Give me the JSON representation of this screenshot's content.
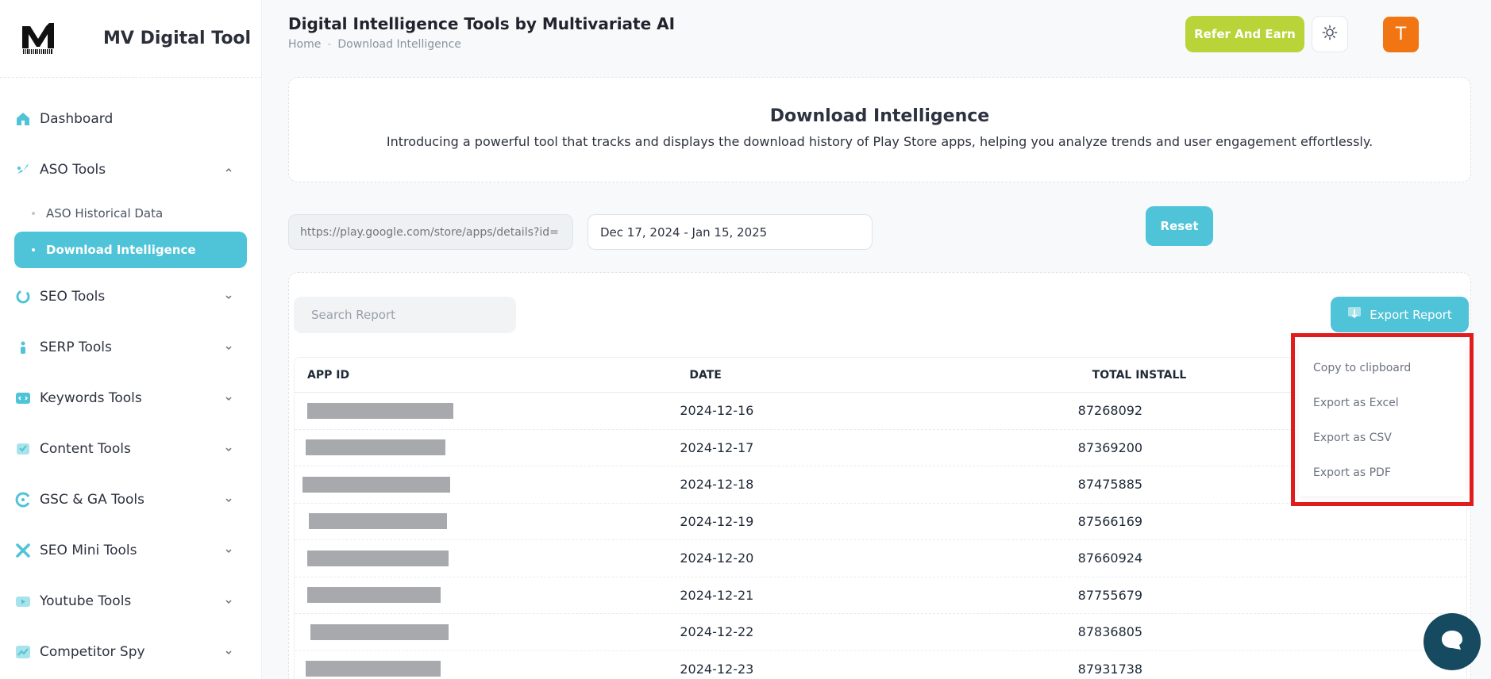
{
  "brand": {
    "name": "MV Digital Tool"
  },
  "sidebar": {
    "items": [
      {
        "label": "Dashboard",
        "icon": "home-icon"
      },
      {
        "label": "ASO Tools",
        "icon": "rocket-icon",
        "expanded": true,
        "children": [
          {
            "label": "ASO Historical Data"
          },
          {
            "label": "Download Intelligence",
            "active": true
          }
        ]
      },
      {
        "label": "SEO Tools",
        "icon": "seo-icon"
      },
      {
        "label": "SERP Tools",
        "icon": "serp-icon"
      },
      {
        "label": "Keywords Tools",
        "icon": "code-icon"
      },
      {
        "label": "Content Tools",
        "icon": "content-icon"
      },
      {
        "label": "GSC & GA Tools",
        "icon": "gsc-icon"
      },
      {
        "label": "SEO Mini Tools",
        "icon": "tools-icon"
      },
      {
        "label": "Youtube Tools",
        "icon": "youtube-icon"
      },
      {
        "label": "Competitor Spy",
        "icon": "chart-icon"
      }
    ]
  },
  "header": {
    "title": "Digital Intelligence Tools by Multivariate AI",
    "breadcrumb": [
      "Home",
      "Download Intelligence"
    ],
    "refer_label": "Refer And Earn",
    "avatar_initial": "T"
  },
  "intro": {
    "title": "Download Intelligence",
    "description": "Introducing a powerful tool that tracks and displays the download history of Play Store apps, helping you analyze trends and user engagement effortlessly."
  },
  "filters": {
    "url_placeholder": "https://play.google.com/store/apps/details?id=",
    "date_range": "Dec 17, 2024 - Jan 15, 2025",
    "reset_label": "Reset"
  },
  "report": {
    "search_placeholder": "Search Report",
    "export_label": "Export Report",
    "columns": [
      "APP ID",
      "DATE",
      "TOTAL INSTALL"
    ],
    "rows": [
      {
        "date": "2024-12-16",
        "installs": "87268092"
      },
      {
        "date": "2024-12-17",
        "installs": "87369200"
      },
      {
        "date": "2024-12-18",
        "installs": "87475885"
      },
      {
        "date": "2024-12-19",
        "installs": "87566169"
      },
      {
        "date": "2024-12-20",
        "installs": "87660924"
      },
      {
        "date": "2024-12-21",
        "installs": "87755679"
      },
      {
        "date": "2024-12-22",
        "installs": "87836805"
      },
      {
        "date": "2024-12-23",
        "installs": "87931738"
      }
    ]
  },
  "export_menu": {
    "items": [
      "Copy to clipboard",
      "Export as Excel",
      "Export as CSV",
      "Export as PDF"
    ]
  },
  "colors": {
    "accent": "#4fc3d7",
    "refer": "#b8d438",
    "avatar": "#f27513",
    "highlight": "#e01c1c",
    "chat": "#154a60"
  }
}
